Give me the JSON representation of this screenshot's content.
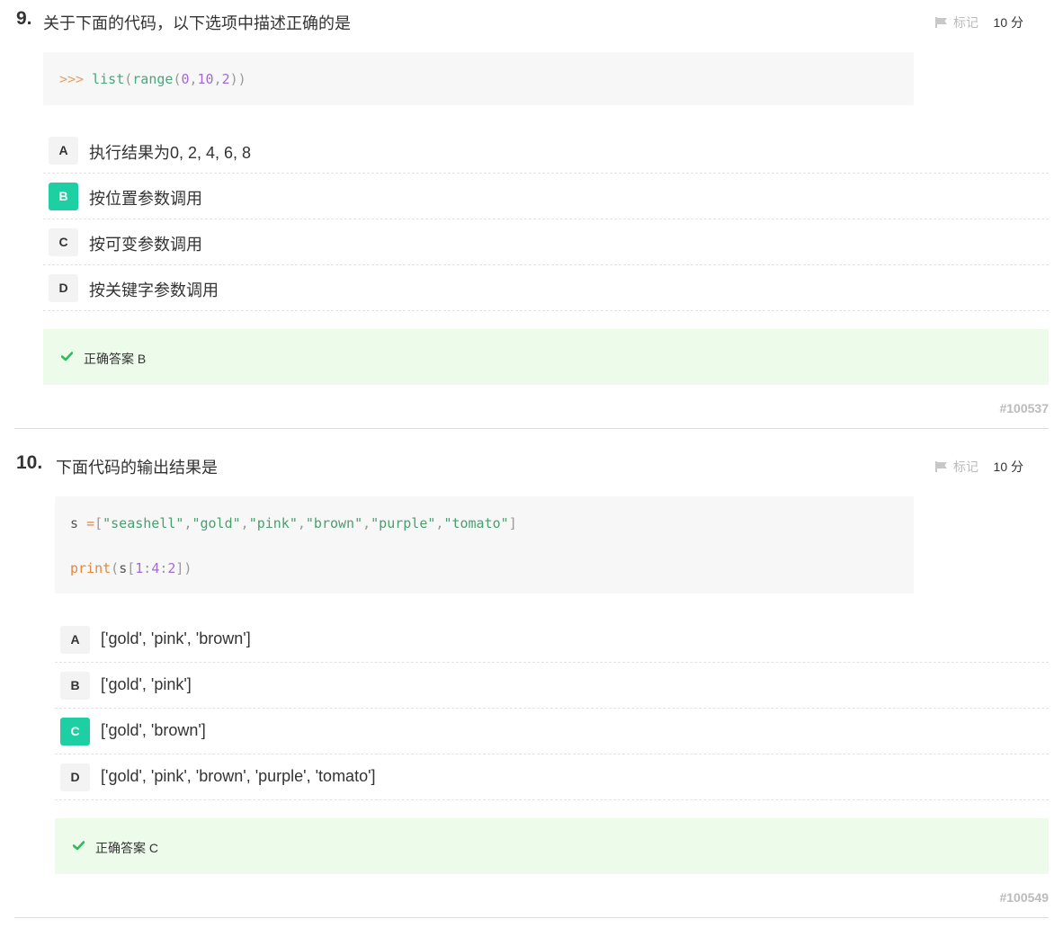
{
  "questions": [
    {
      "number": "9.",
      "title": "关于下面的代码，以下选项中描述正确的是",
      "mark_label": "标记",
      "score": "10 分",
      "code_lines": [
        [
          {
            "t": ">>> ",
            "c": "prompt"
          },
          {
            "t": "list",
            "c": "fn"
          },
          {
            "t": "(",
            "c": "paren"
          },
          {
            "t": "range",
            "c": "fn"
          },
          {
            "t": "(",
            "c": "paren"
          },
          {
            "t": "0",
            "c": "num"
          },
          {
            "t": ",",
            "c": "paren"
          },
          {
            "t": "10",
            "c": "num"
          },
          {
            "t": ",",
            "c": "paren"
          },
          {
            "t": "2",
            "c": "num"
          },
          {
            "t": "))",
            "c": "paren"
          }
        ]
      ],
      "options": [
        {
          "letter": "A",
          "text": "执行结果为0, 2, 4, 6, 8",
          "correct": false
        },
        {
          "letter": "B",
          "text": "按位置参数调用",
          "correct": true
        },
        {
          "letter": "C",
          "text": "按可变参数调用",
          "correct": false
        },
        {
          "letter": "D",
          "text": "按关键字参数调用",
          "correct": false
        }
      ],
      "answer": "正确答案 B",
      "id": "#100537"
    },
    {
      "number": "10.",
      "title": "下面代码的输出结果是",
      "mark_label": "标记",
      "score": "10 分",
      "code_lines": [
        [
          {
            "t": "s ",
            "c": "var"
          },
          {
            "t": "=",
            "c": "op"
          },
          {
            "t": "[",
            "c": "paren"
          },
          {
            "t": "\"seashell\"",
            "c": "str"
          },
          {
            "t": ",",
            "c": "paren"
          },
          {
            "t": "\"gold\"",
            "c": "str"
          },
          {
            "t": ",",
            "c": "paren"
          },
          {
            "t": "\"pink\"",
            "c": "str"
          },
          {
            "t": ",",
            "c": "paren"
          },
          {
            "t": "\"brown\"",
            "c": "str"
          },
          {
            "t": ",",
            "c": "paren"
          },
          {
            "t": "\"purple\"",
            "c": "str"
          },
          {
            "t": ",",
            "c": "paren"
          },
          {
            "t": "\"tomato\"",
            "c": "str"
          },
          {
            "t": "]",
            "c": "paren"
          }
        ],
        [
          {
            "t": "print",
            "c": "kw"
          },
          {
            "t": "(",
            "c": "paren"
          },
          {
            "t": "s",
            "c": "var"
          },
          {
            "t": "[",
            "c": "paren"
          },
          {
            "t": "1",
            "c": "num"
          },
          {
            "t": ":",
            "c": "paren"
          },
          {
            "t": "4",
            "c": "num"
          },
          {
            "t": ":",
            "c": "paren"
          },
          {
            "t": "2",
            "c": "num"
          },
          {
            "t": "])",
            "c": "paren"
          }
        ]
      ],
      "options": [
        {
          "letter": "A",
          "text": "['gold', 'pink', 'brown']",
          "correct": false
        },
        {
          "letter": "B",
          "text": "['gold', 'pink']",
          "correct": false
        },
        {
          "letter": "C",
          "text": "['gold', 'brown']",
          "correct": true
        },
        {
          "letter": "D",
          "text": "['gold', 'pink', 'brown', 'purple', 'tomato']",
          "correct": false
        }
      ],
      "answer": "正确答案 C",
      "id": "#100549"
    }
  ],
  "icons": {
    "mark": "flag-icon",
    "answer": "check-icon"
  },
  "colors": {
    "correct_option": "#1ecfa3",
    "answer_bg": "#edfbea",
    "check": "#2dbb5d"
  }
}
